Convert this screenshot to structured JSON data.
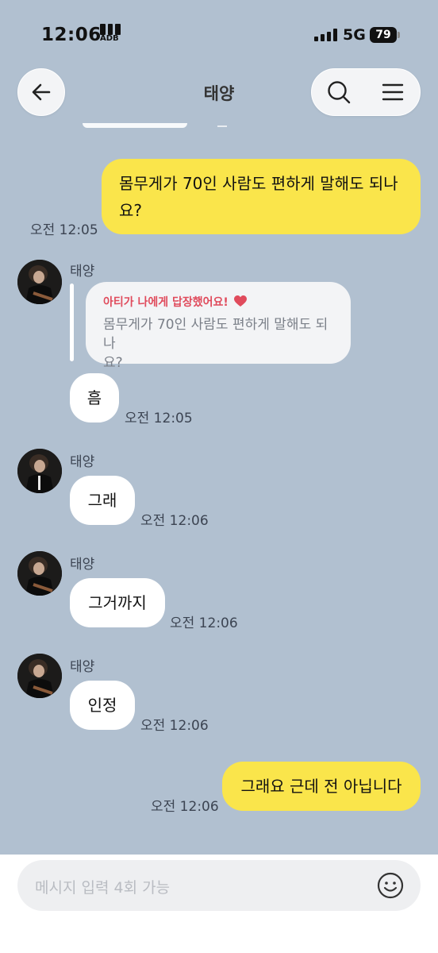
{
  "status_bar": {
    "time": "12:06",
    "carrier_tag": "ADB",
    "network": "5G",
    "battery": "79"
  },
  "header": {
    "title": "태양",
    "back_icon": "arrow-left-icon",
    "search_icon": "search-icon",
    "menu_icon": "menu-icon"
  },
  "messages": {
    "m1": {
      "text_line1": "몸무게가 70인 사람도 편하게 말해도 되나",
      "text_line2": "요?",
      "time": "오전 12:05"
    },
    "m2": {
      "sender": "태양",
      "reply_head": "아티가 나에게 답장했어요!",
      "reply_line1": "몸무게가 70인 사람도 편하게 말해도 되나",
      "reply_line2": "요?",
      "text": "흠",
      "time": "오전 12:05"
    },
    "m3": {
      "sender": "태양",
      "text": "그래",
      "time": "오전 12:06"
    },
    "m4": {
      "sender": "태양",
      "text": "그거까지",
      "time": "오전 12:06"
    },
    "m5": {
      "sender": "태양",
      "text": "인정",
      "time": "오전 12:06"
    },
    "m6": {
      "text": "그래요 근데 전 아닙니다",
      "time": "오전 12:06"
    }
  },
  "composer": {
    "placeholder": "메시지 입력 4회 가능",
    "emoji_icon": "smiley-icon"
  },
  "colors": {
    "background": "#b1c0d0",
    "my_bubble": "#fae54b",
    "their_bubble": "#ffffff",
    "reply_accent": "#e04b5c"
  }
}
